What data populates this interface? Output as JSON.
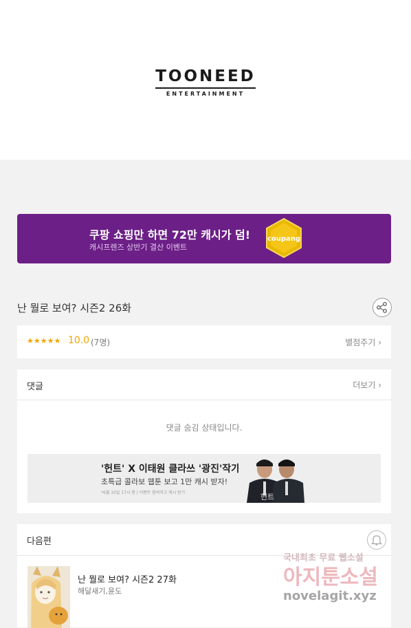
{
  "logo": {
    "main": "TOONEED",
    "sub": "ENTERTAINMENT"
  },
  "banner": {
    "title": "쿠팡 쇼핑만 하면 72만 캐시가 덤!",
    "subtitle": "캐시프렌즈 상반기 결산 이벤트",
    "coin_label": "coupang"
  },
  "episode": {
    "title": "난 뭘로 보여? 시즌2 26화"
  },
  "rating": {
    "stars": "★★★★★",
    "score": "10.0",
    "count": "(7명)",
    "action": "별점주기 ›"
  },
  "comments": {
    "header": "댓글",
    "more": "더보기 ›",
    "hidden_message": "댓글 숨김 상태입니다."
  },
  "ad": {
    "title": "'헌트' X 이태원 클라쓰 '광진'작가",
    "subtitle": "초특급 콜라보 웹툰 보고 1만 캐시 받자!",
    "fine_print": "*6월 10일 17시 종 | 이벤트 참여하고 캐시 받기",
    "poster_text": "헌트"
  },
  "next": {
    "header": "다음편",
    "title": "난 뭘로 보여? 시즌2 27화",
    "author": "해달새기,윤도"
  },
  "watermark": {
    "line1": "국내최초 무료 웹소설",
    "line2": "아지툰소설",
    "line3": "novelagit.xyz"
  }
}
